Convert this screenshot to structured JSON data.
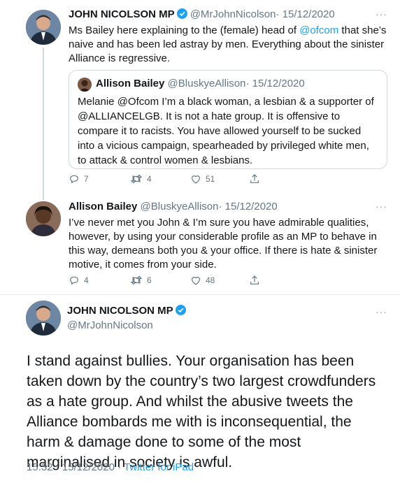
{
  "tweet1": {
    "name": "JOHN NICOLSON MP",
    "handle": "@MrJohnNicolson",
    "date": "· 15/12/2020",
    "text_pre": "Ms Bailey here explaining to the (female) head of ",
    "mention": "@ofcom",
    "text_post": " that she’s naive and has been led astray by men. Everything about the sinister Alliance is regressive.",
    "quote": {
      "name": "Allison Bailey",
      "handle": "@BluskyeAllison",
      "date": "· 15/12/2020",
      "text": "Melanie @Ofcom I’m a black woman, a lesbian & a supporter of @ALLIANCELGB. It is not a hate group. It is offensive to compare it to racists. You have allowed yourself to be sucked into a vicious campaign, spearheaded by privileged white men, to attack & control women & lesbians."
    },
    "counts": {
      "replies": "7",
      "retweets": "4",
      "likes": "51"
    }
  },
  "tweet2": {
    "name": "Allison Bailey",
    "handle": "@BluskyeAllison",
    "date": "· 15/12/2020",
    "text": "I’ve never met you John & I’m sure you have admirable qualities, however, by using your considerable profile as an MP to behave in this way, demeans both you & your office. If there is hate & sinister motive, it comes from your side.",
    "counts": {
      "replies": "4",
      "retweets": "6",
      "likes": "48"
    }
  },
  "tweet3": {
    "name": "JOHN NICOLSON MP",
    "handle": "@MrJohnNicolson",
    "text": "I stand against bullies. Your organisation has been taken down by the country’s two largest crowdfunders as a hate group. And whilst the abusive tweets the Alliance bombards me with is inconsequential, the harm & damage done to some of the most marginalised in society is awful.",
    "time": "15:32",
    "date": "· 15/12/2020 ·",
    "source": "Twitter for iPad"
  },
  "more_glyph": "···",
  "colors": {
    "accent": "#1da1f2",
    "muted": "#657786",
    "border": "#cfd9de"
  },
  "icons": [
    "verified-badge-icon",
    "reply-icon",
    "retweet-icon",
    "like-icon",
    "share-icon",
    "more-icon"
  ]
}
